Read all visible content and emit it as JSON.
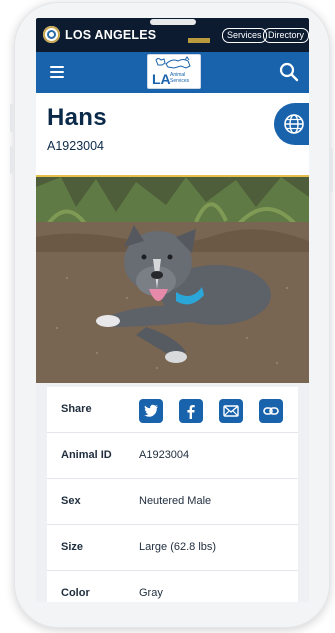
{
  "header": {
    "city_name": "LOS ANGELES",
    "links": [
      "Services",
      "Directory"
    ],
    "logo_text": "LA",
    "logo_sub": "Animal Services"
  },
  "animal": {
    "name": "Hans",
    "id": "A1923004"
  },
  "share": {
    "label": "Share",
    "icons": [
      "twitter-icon",
      "facebook-icon",
      "email-icon",
      "link-icon"
    ]
  },
  "details": [
    {
      "label": "Animal ID",
      "value": "A1923004"
    },
    {
      "label": "Sex",
      "value": "Neutered Male"
    },
    {
      "label": "Size",
      "value": "Large (62.8 lbs)"
    },
    {
      "label": "Color",
      "value": "Gray"
    }
  ],
  "colors": {
    "brand_blue": "#1863ac",
    "top_bar": "#0c1b30",
    "accent_gold": "#e7c04b",
    "title_text": "#0b2a4a"
  }
}
